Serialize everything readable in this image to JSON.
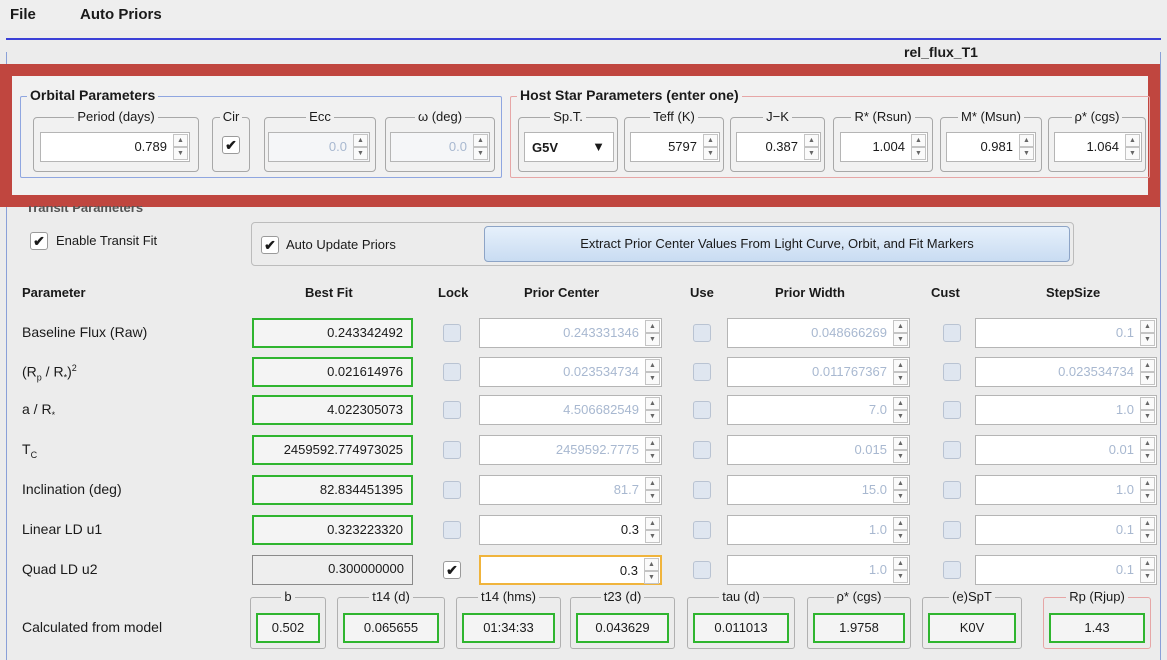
{
  "menu": {
    "file": "File",
    "auto_priors": "Auto Priors"
  },
  "panel_title": "rel_flux_T1",
  "orbital": {
    "title": "Orbital Parameters",
    "period_label": "Period (days)",
    "period_value": "0.789",
    "cir_label": "Cir",
    "cir_checked": "✔",
    "ecc_label": "Ecc",
    "ecc_value": "0.0",
    "omega_label": "ω (deg)",
    "omega_value": "0.0"
  },
  "host": {
    "title": "Host Star Parameters (enter one)",
    "spt_label": "Sp.T.",
    "spt_value": "G5V",
    "teff_label": "Teff (K)",
    "teff_value": "5797",
    "jk_label": "J−K",
    "jk_value": "0.387",
    "rstar_label": "R* (Rsun)",
    "rstar_value": "1.004",
    "mstar_label": "M* (Msun)",
    "mstar_value": "0.981",
    "rho_label": "ρ* (cgs)",
    "rho_value": "1.064"
  },
  "transit": {
    "title": "Transit Parameters",
    "enable_label": "Enable Transit Fit",
    "auto_update_label": "Auto Update Priors",
    "extract_button": "Extract Prior Center Values From Light Curve, Orbit, and Fit Markers",
    "headers": {
      "parameter": "Parameter",
      "best_fit": "Best Fit",
      "lock": "Lock",
      "prior_center": "Prior Center",
      "use": "Use",
      "prior_width": "Prior Width",
      "cust": "Cust",
      "step_size": "StepSize"
    },
    "rows": [
      {
        "label": "Baseline Flux (Raw)",
        "best_fit": "0.243342492",
        "prior_center": "0.243331346",
        "prior_width": "0.048666269",
        "step": "0.1"
      },
      {
        "label": "(Rp / R*)2",
        "best_fit": "0.021614976",
        "prior_center": "0.023534734",
        "prior_width": "0.011767367",
        "step": "0.023534734"
      },
      {
        "label": "a / R*",
        "best_fit": "4.022305073",
        "prior_center": "4.506682549",
        "prior_width": "7.0",
        "step": "1.0"
      },
      {
        "label": "TC",
        "best_fit": "2459592.774973025",
        "prior_center": "2459592.7775",
        "prior_width": "0.015",
        "step": "0.01"
      },
      {
        "label": "Inclination (deg)",
        "best_fit": "82.834451395",
        "prior_center": "81.7",
        "prior_width": "15.0",
        "step": "1.0"
      },
      {
        "label": "Linear LD u1",
        "best_fit": "0.323223320",
        "prior_center": "0.3",
        "prior_width": "1.0",
        "step": "0.1"
      },
      {
        "label": "Quad LD u2",
        "best_fit": "0.300000000",
        "prior_center": "0.3",
        "prior_width": "1.0",
        "step": "0.1"
      }
    ],
    "lock_checked": "✔",
    "calc_label": "Calculated from model",
    "calc": [
      {
        "label": "b",
        "value": "0.502"
      },
      {
        "label": "t14 (d)",
        "value": "0.065655"
      },
      {
        "label": "t14 (hms)",
        "value": "01:34:33"
      },
      {
        "label": "t23 (d)",
        "value": "0.043629"
      },
      {
        "label": "tau (d)",
        "value": "0.011013"
      },
      {
        "label": "ρ* (cgs)",
        "value": "1.9758"
      },
      {
        "label": "(e)SpT",
        "value": "K0V"
      },
      {
        "label": "Rp (Rjup)",
        "value": "1.43"
      }
    ]
  },
  "colors": {
    "highlight": "#c0463f",
    "fit_green": "#2fb52f",
    "title_line": "#3a3fd6"
  }
}
